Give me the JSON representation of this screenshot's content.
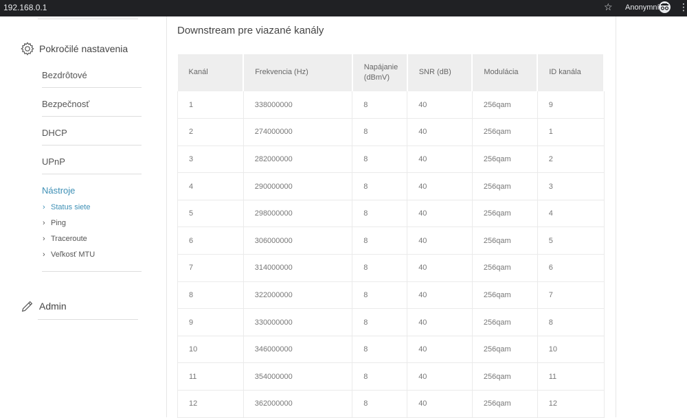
{
  "browser": {
    "url": "192.168.0.1",
    "profile_label": "Anonymní",
    "star_icon": "star-outline-icon",
    "menu_icon": "vertical-dots-icon"
  },
  "sidebar": {
    "advanced_title": "Pokročilé nastavenia",
    "items": [
      {
        "label": "Bezdrôtové"
      },
      {
        "label": "Bezpečnosť"
      },
      {
        "label": "DHCP"
      },
      {
        "label": "UPnP"
      },
      {
        "label": "Nástroje"
      }
    ],
    "tools_sub": [
      {
        "label": "Status siete"
      },
      {
        "label": "Ping"
      },
      {
        "label": "Traceroute"
      },
      {
        "label": "Veľkosť MTU"
      }
    ],
    "admin_title": "Admin"
  },
  "main": {
    "title": "Downstream pre viazané kanály",
    "columns": [
      "Kanál",
      "Frekvencia (Hz)",
      "Napájanie (dBmV)",
      "SNR (dB)",
      "Modulácia",
      "ID kanála"
    ],
    "rows": [
      [
        "1",
        "338000000",
        "8",
        "40",
        "256qam",
        "9"
      ],
      [
        "2",
        "274000000",
        "8",
        "40",
        "256qam",
        "1"
      ],
      [
        "3",
        "282000000",
        "8",
        "40",
        "256qam",
        "2"
      ],
      [
        "4",
        "290000000",
        "8",
        "40",
        "256qam",
        "3"
      ],
      [
        "5",
        "298000000",
        "8",
        "40",
        "256qam",
        "4"
      ],
      [
        "6",
        "306000000",
        "8",
        "40",
        "256qam",
        "5"
      ],
      [
        "7",
        "314000000",
        "8",
        "40",
        "256qam",
        "6"
      ],
      [
        "8",
        "322000000",
        "8",
        "40",
        "256qam",
        "7"
      ],
      [
        "9",
        "330000000",
        "8",
        "40",
        "256qam",
        "8"
      ],
      [
        "10",
        "346000000",
        "8",
        "40",
        "256qam",
        "10"
      ],
      [
        "11",
        "354000000",
        "8",
        "40",
        "256qam",
        "11"
      ],
      [
        "12",
        "362000000",
        "8",
        "40",
        "256qam",
        "12"
      ]
    ]
  },
  "colors": {
    "accent": "#3d8fb5",
    "header_bg": "#eeeeee",
    "topbar": "#202124"
  }
}
